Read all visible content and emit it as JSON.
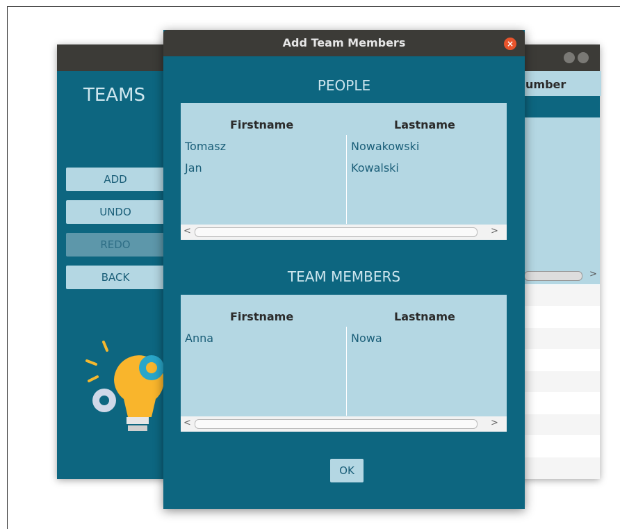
{
  "background_window": {
    "app_title": "TEAMS",
    "buttons": {
      "add": "ADD",
      "undo": "UNDO",
      "redo": "REDO",
      "back": "BACK"
    },
    "table": {
      "partial_header": "umber"
    },
    "scroll_arrow_right": ">"
  },
  "dialog": {
    "title": "Add Team Members",
    "close_symbol": "×",
    "people": {
      "title": "PEOPLE",
      "columns": [
        "Firstname",
        "Lastname"
      ],
      "rows": [
        [
          "Tomasz",
          "Nowakowski"
        ],
        [
          "Jan",
          "Kowalski"
        ]
      ]
    },
    "team_members": {
      "title": "TEAM MEMBERS",
      "columns": [
        "Firstname",
        "Lastname"
      ],
      "rows": [
        [
          "Anna",
          "Nowa"
        ]
      ]
    },
    "scroll_arrows": {
      "left": "<",
      "right": ">"
    },
    "ok_label": "OK"
  },
  "colors": {
    "window_bg": "#0d6680",
    "table_bg": "#b4d7e3",
    "titlebar": "#3c3b37",
    "close_button": "#e9542c"
  }
}
